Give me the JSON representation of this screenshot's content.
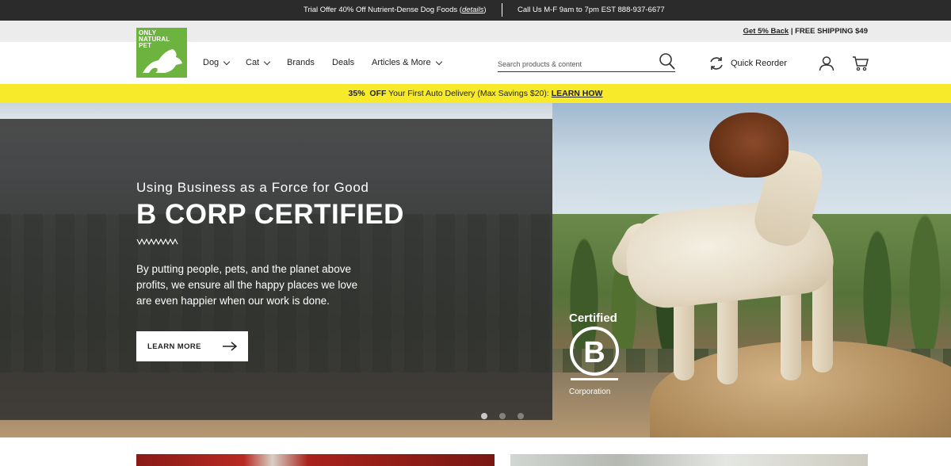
{
  "topbar": {
    "offer_prefix": "Trial Offer 40% Off Nutrient-Dense Dog Foods (",
    "offer_link": "details",
    "offer_suffix": ")",
    "call": "Call Us M-F 9am to 7pm EST 888-937-6677"
  },
  "utility": {
    "cashback_link": "Get 5% Back",
    "shipping": " | FREE SHIPPING $49"
  },
  "logo": {
    "line1": "ONLY",
    "line2": "NATURAL",
    "line3": "PET",
    "color": "#6db33f"
  },
  "nav": {
    "items": [
      {
        "label": "Dog",
        "has_dropdown": true
      },
      {
        "label": "Cat",
        "has_dropdown": true
      },
      {
        "label": "Brands",
        "has_dropdown": false
      },
      {
        "label": "Deals",
        "has_dropdown": false
      },
      {
        "label": "Articles & More",
        "has_dropdown": true
      }
    ]
  },
  "search": {
    "placeholder": "Search products & content",
    "icon": "search-icon"
  },
  "header_actions": {
    "reorder_label": "Quick Reorder",
    "reorder_icon": "refresh-icon",
    "account_icon": "user-icon",
    "cart_icon": "cart-icon"
  },
  "promo": {
    "percent": "35%",
    "off": "OFF",
    "text": " Your First Auto Delivery (Max Savings $20): ",
    "link": "LEARN HOW",
    "color": "#f7ea2b"
  },
  "hero": {
    "eyebrow": "Using Business as a Force for Good",
    "title": "B CORP CERTIFIED",
    "body": "By putting people, pets, and the planet above profits, we ensure all the happy places we love are even happier when our work is done.",
    "cta_label": "LEARN MORE",
    "badge_top": "Certified",
    "badge_letter": "B",
    "badge_bottom": "Corporation",
    "slides_total": 3,
    "active_slide": 1
  }
}
